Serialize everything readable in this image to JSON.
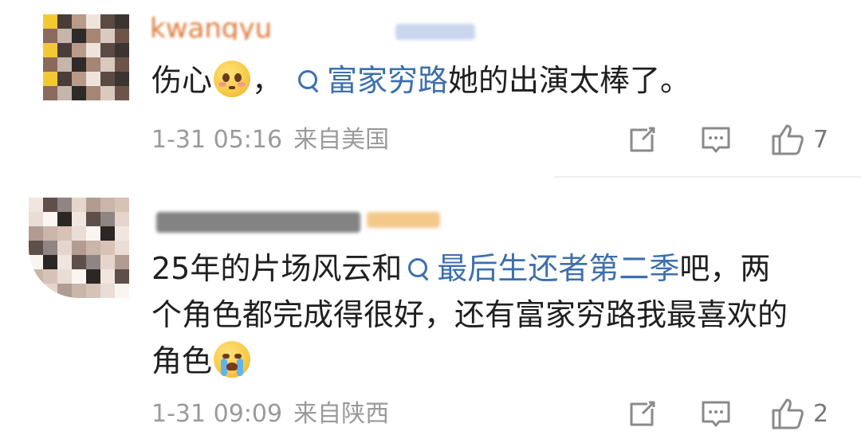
{
  "comments": [
    {
      "username": "kwangyu_",
      "content": {
        "prefix": "伤心",
        "after_emoji": "，",
        "topic": "富家穷路",
        "suffix": "她的出演太棒了。"
      },
      "emoji_icon": "pleading-face-emoji",
      "date": "1-31 05:16",
      "location": "来自美国",
      "likes": "7"
    },
    {
      "username": "",
      "content": {
        "line1_prefix": "25年的片场风云和",
        "topic": "最后生还者第二季",
        "line1_suffix": "吧，两",
        "line2": "个角色都完成得很好，还有富家穷路我最喜欢的",
        "line3": "角色"
      },
      "emoji_icon": "crying-face-emoji",
      "date": "1-31 09:09",
      "location": "来自陕西",
      "likes": "2"
    }
  ],
  "colors": {
    "topic_link": "#3d6fae",
    "meta_text": "#9a9a9a",
    "icon_stroke": "#8a8a8a"
  }
}
